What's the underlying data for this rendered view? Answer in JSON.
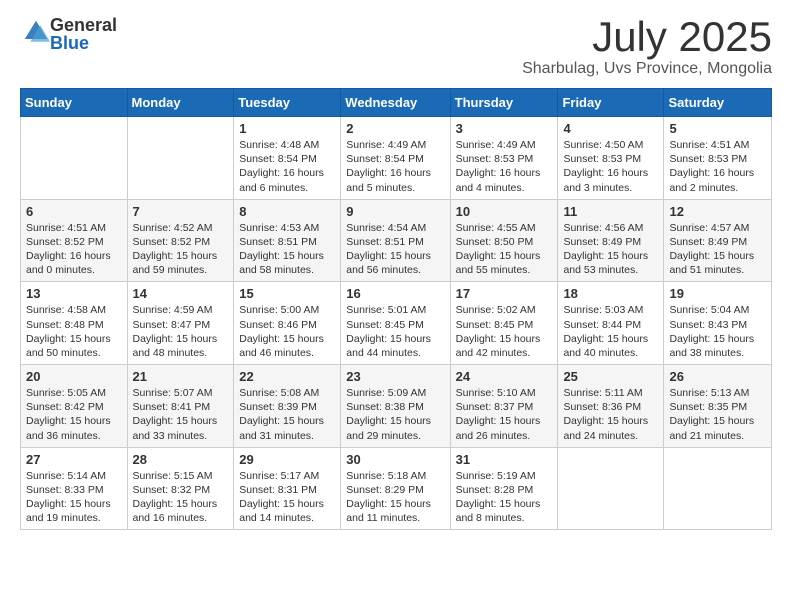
{
  "logo": {
    "general": "General",
    "blue": "Blue"
  },
  "title": "July 2025",
  "location": "Sharbulag, Uvs Province, Mongolia",
  "days_of_week": [
    "Sunday",
    "Monday",
    "Tuesday",
    "Wednesday",
    "Thursday",
    "Friday",
    "Saturday"
  ],
  "weeks": [
    [
      {
        "day": "",
        "sunrise": "",
        "sunset": "",
        "daylight": ""
      },
      {
        "day": "",
        "sunrise": "",
        "sunset": "",
        "daylight": ""
      },
      {
        "day": "1",
        "sunrise": "Sunrise: 4:48 AM",
        "sunset": "Sunset: 8:54 PM",
        "daylight": "Daylight: 16 hours and 6 minutes."
      },
      {
        "day": "2",
        "sunrise": "Sunrise: 4:49 AM",
        "sunset": "Sunset: 8:54 PM",
        "daylight": "Daylight: 16 hours and 5 minutes."
      },
      {
        "day": "3",
        "sunrise": "Sunrise: 4:49 AM",
        "sunset": "Sunset: 8:53 PM",
        "daylight": "Daylight: 16 hours and 4 minutes."
      },
      {
        "day": "4",
        "sunrise": "Sunrise: 4:50 AM",
        "sunset": "Sunset: 8:53 PM",
        "daylight": "Daylight: 16 hours and 3 minutes."
      },
      {
        "day": "5",
        "sunrise": "Sunrise: 4:51 AM",
        "sunset": "Sunset: 8:53 PM",
        "daylight": "Daylight: 16 hours and 2 minutes."
      }
    ],
    [
      {
        "day": "6",
        "sunrise": "Sunrise: 4:51 AM",
        "sunset": "Sunset: 8:52 PM",
        "daylight": "Daylight: 16 hours and 0 minutes."
      },
      {
        "day": "7",
        "sunrise": "Sunrise: 4:52 AM",
        "sunset": "Sunset: 8:52 PM",
        "daylight": "Daylight: 15 hours and 59 minutes."
      },
      {
        "day": "8",
        "sunrise": "Sunrise: 4:53 AM",
        "sunset": "Sunset: 8:51 PM",
        "daylight": "Daylight: 15 hours and 58 minutes."
      },
      {
        "day": "9",
        "sunrise": "Sunrise: 4:54 AM",
        "sunset": "Sunset: 8:51 PM",
        "daylight": "Daylight: 15 hours and 56 minutes."
      },
      {
        "day": "10",
        "sunrise": "Sunrise: 4:55 AM",
        "sunset": "Sunset: 8:50 PM",
        "daylight": "Daylight: 15 hours and 55 minutes."
      },
      {
        "day": "11",
        "sunrise": "Sunrise: 4:56 AM",
        "sunset": "Sunset: 8:49 PM",
        "daylight": "Daylight: 15 hours and 53 minutes."
      },
      {
        "day": "12",
        "sunrise": "Sunrise: 4:57 AM",
        "sunset": "Sunset: 8:49 PM",
        "daylight": "Daylight: 15 hours and 51 minutes."
      }
    ],
    [
      {
        "day": "13",
        "sunrise": "Sunrise: 4:58 AM",
        "sunset": "Sunset: 8:48 PM",
        "daylight": "Daylight: 15 hours and 50 minutes."
      },
      {
        "day": "14",
        "sunrise": "Sunrise: 4:59 AM",
        "sunset": "Sunset: 8:47 PM",
        "daylight": "Daylight: 15 hours and 48 minutes."
      },
      {
        "day": "15",
        "sunrise": "Sunrise: 5:00 AM",
        "sunset": "Sunset: 8:46 PM",
        "daylight": "Daylight: 15 hours and 46 minutes."
      },
      {
        "day": "16",
        "sunrise": "Sunrise: 5:01 AM",
        "sunset": "Sunset: 8:45 PM",
        "daylight": "Daylight: 15 hours and 44 minutes."
      },
      {
        "day": "17",
        "sunrise": "Sunrise: 5:02 AM",
        "sunset": "Sunset: 8:45 PM",
        "daylight": "Daylight: 15 hours and 42 minutes."
      },
      {
        "day": "18",
        "sunrise": "Sunrise: 5:03 AM",
        "sunset": "Sunset: 8:44 PM",
        "daylight": "Daylight: 15 hours and 40 minutes."
      },
      {
        "day": "19",
        "sunrise": "Sunrise: 5:04 AM",
        "sunset": "Sunset: 8:43 PM",
        "daylight": "Daylight: 15 hours and 38 minutes."
      }
    ],
    [
      {
        "day": "20",
        "sunrise": "Sunrise: 5:05 AM",
        "sunset": "Sunset: 8:42 PM",
        "daylight": "Daylight: 15 hours and 36 minutes."
      },
      {
        "day": "21",
        "sunrise": "Sunrise: 5:07 AM",
        "sunset": "Sunset: 8:41 PM",
        "daylight": "Daylight: 15 hours and 33 minutes."
      },
      {
        "day": "22",
        "sunrise": "Sunrise: 5:08 AM",
        "sunset": "Sunset: 8:39 PM",
        "daylight": "Daylight: 15 hours and 31 minutes."
      },
      {
        "day": "23",
        "sunrise": "Sunrise: 5:09 AM",
        "sunset": "Sunset: 8:38 PM",
        "daylight": "Daylight: 15 hours and 29 minutes."
      },
      {
        "day": "24",
        "sunrise": "Sunrise: 5:10 AM",
        "sunset": "Sunset: 8:37 PM",
        "daylight": "Daylight: 15 hours and 26 minutes."
      },
      {
        "day": "25",
        "sunrise": "Sunrise: 5:11 AM",
        "sunset": "Sunset: 8:36 PM",
        "daylight": "Daylight: 15 hours and 24 minutes."
      },
      {
        "day": "26",
        "sunrise": "Sunrise: 5:13 AM",
        "sunset": "Sunset: 8:35 PM",
        "daylight": "Daylight: 15 hours and 21 minutes."
      }
    ],
    [
      {
        "day": "27",
        "sunrise": "Sunrise: 5:14 AM",
        "sunset": "Sunset: 8:33 PM",
        "daylight": "Daylight: 15 hours and 19 minutes."
      },
      {
        "day": "28",
        "sunrise": "Sunrise: 5:15 AM",
        "sunset": "Sunset: 8:32 PM",
        "daylight": "Daylight: 15 hours and 16 minutes."
      },
      {
        "day": "29",
        "sunrise": "Sunrise: 5:17 AM",
        "sunset": "Sunset: 8:31 PM",
        "daylight": "Daylight: 15 hours and 14 minutes."
      },
      {
        "day": "30",
        "sunrise": "Sunrise: 5:18 AM",
        "sunset": "Sunset: 8:29 PM",
        "daylight": "Daylight: 15 hours and 11 minutes."
      },
      {
        "day": "31",
        "sunrise": "Sunrise: 5:19 AM",
        "sunset": "Sunset: 8:28 PM",
        "daylight": "Daylight: 15 hours and 8 minutes."
      },
      {
        "day": "",
        "sunrise": "",
        "sunset": "",
        "daylight": ""
      },
      {
        "day": "",
        "sunrise": "",
        "sunset": "",
        "daylight": ""
      }
    ]
  ]
}
